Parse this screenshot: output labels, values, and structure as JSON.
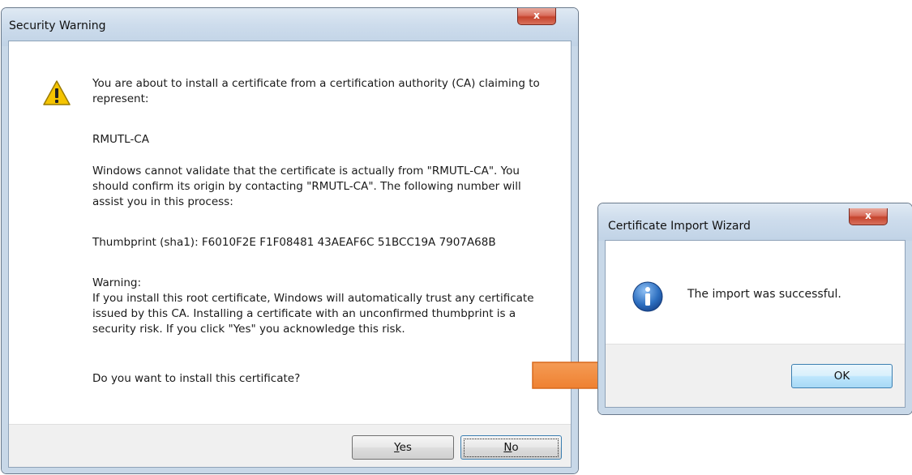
{
  "security_dialog": {
    "title": "Security Warning",
    "close_glyph": "x",
    "icon": "warning-triangle-icon",
    "intro": "You are about to install a certificate from a certification authority (CA) claiming to represent:",
    "ca_name": "RMUTL-CA",
    "validation_text": "Windows cannot validate that the certificate is actually from \"RMUTL-CA\". You should confirm its origin by contacting \"RMUTL-CA\". The following number will assist you in this process:",
    "thumbprint_label": "Thumbprint (sha1):",
    "thumbprint_value": "F6010F2E F1F08481 43AEAF6C 51BCC19A 7907A68B",
    "warning_heading": "Warning:",
    "warning_text": "If you install this root certificate, Windows will automatically trust any certificate issued by this CA. Installing a certificate with an unconfirmed thumbprint is a security risk. If you click \"Yes\" you acknowledge this risk.",
    "question": "Do you want to install this certificate?",
    "yes_mnemonic": "Y",
    "yes_rest": "es",
    "no_mnemonic": "N",
    "no_rest": "o"
  },
  "import_dialog": {
    "title": "Certificate Import Wizard",
    "close_glyph": "x",
    "icon": "info-icon",
    "message": "The import was successful.",
    "ok_label": "OK"
  },
  "arrow": {
    "icon": "right-arrow-icon",
    "color": "#f0822e"
  },
  "colors": {
    "warning_yellow": "#f5c400",
    "info_blue": "#2d6fc0",
    "close_red": "#c5432c"
  }
}
